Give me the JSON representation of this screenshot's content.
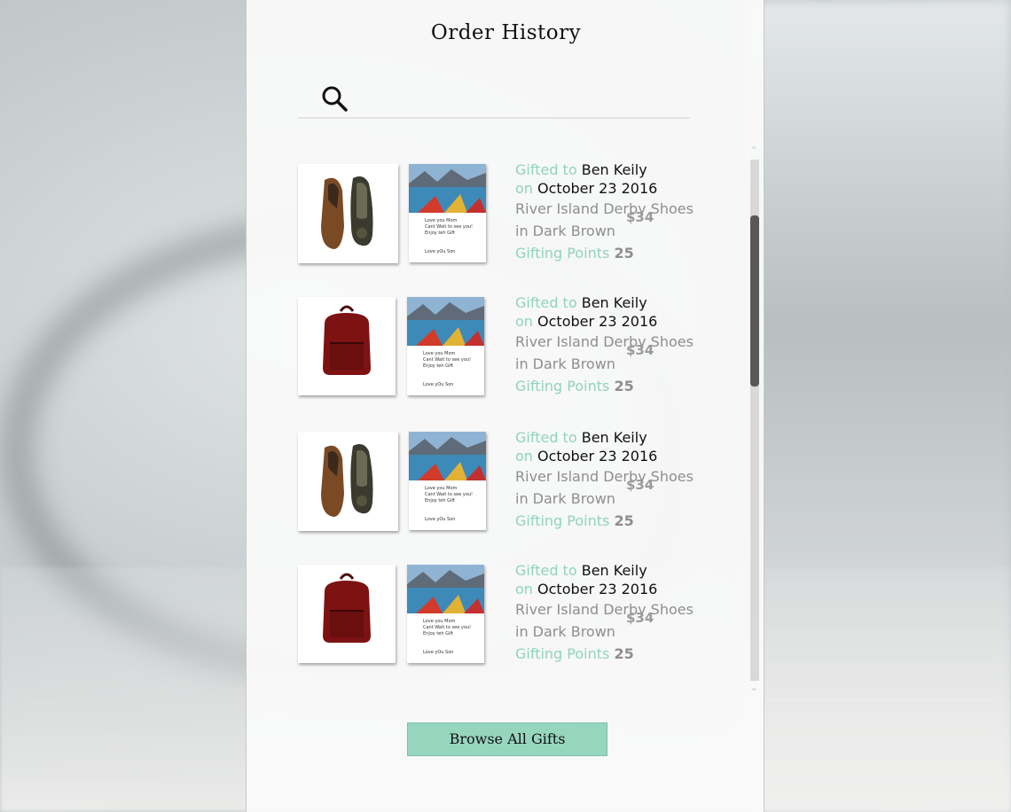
{
  "page": {
    "title": "Order History"
  },
  "search": {
    "placeholder": ""
  },
  "orders": [
    {
      "product_type": "shoes",
      "gifted_to_label": "Gifted to",
      "recipient": "Ben Keily",
      "on_label": "on",
      "date": "October 23 2016",
      "product_line1": "River Island Derby Shoes",
      "product_line2": "in Dark Brown",
      "price": "$34",
      "points_label": "Gifting Points",
      "points": "25",
      "card_message": [
        "Love you Mom",
        "Cant Wait to see you!",
        "Enjoy teh Gift"
      ],
      "card_sign": "Love yOu Son"
    },
    {
      "product_type": "backpack",
      "gifted_to_label": "Gifted to",
      "recipient": "Ben Keily",
      "on_label": "on",
      "date": "October 23 2016",
      "product_line1": "River Island Derby Shoes",
      "product_line2": "in Dark Brown",
      "price": "$34",
      "points_label": "Gifting Points",
      "points": "25",
      "card_message": [
        "Love you Mom",
        "Cant Wait to see you!",
        "Enjoy teh Gift"
      ],
      "card_sign": "Love yOu Son"
    },
    {
      "product_type": "shoes",
      "gifted_to_label": "Gifted to",
      "recipient": "Ben Keily",
      "on_label": "on",
      "date": "October 23 2016",
      "product_line1": "River Island Derby Shoes",
      "product_line2": "in Dark Brown",
      "price": "$34",
      "points_label": "Gifting Points",
      "points": "25",
      "card_message": [
        "Love you Mom",
        "Cant Wait to see you!",
        "Enjoy teh Gift"
      ],
      "card_sign": "Love yOu Son"
    },
    {
      "product_type": "backpack",
      "gifted_to_label": "Gifted to",
      "recipient": "Ben Keily",
      "on_label": "on",
      "date": "October 23 2016",
      "product_line1": "River Island Derby Shoes",
      "product_line2": "in Dark Brown",
      "price": "$34",
      "points_label": "Gifting Points",
      "points": "25",
      "card_message": [
        "Love you Mom",
        "Cant Wait to see you!",
        "Enjoy teh Gift"
      ],
      "card_sign": "Love yOu Son"
    }
  ],
  "footer": {
    "browse_label": "Browse All Gifts"
  },
  "colors": {
    "accent": "#8fd4bc",
    "button": "#96d6bf",
    "scroll_thumb": "#585858"
  },
  "icons": {
    "search": "search-icon",
    "scroll_up": "chevron-up-icon",
    "scroll_down": "chevron-down-icon"
  }
}
